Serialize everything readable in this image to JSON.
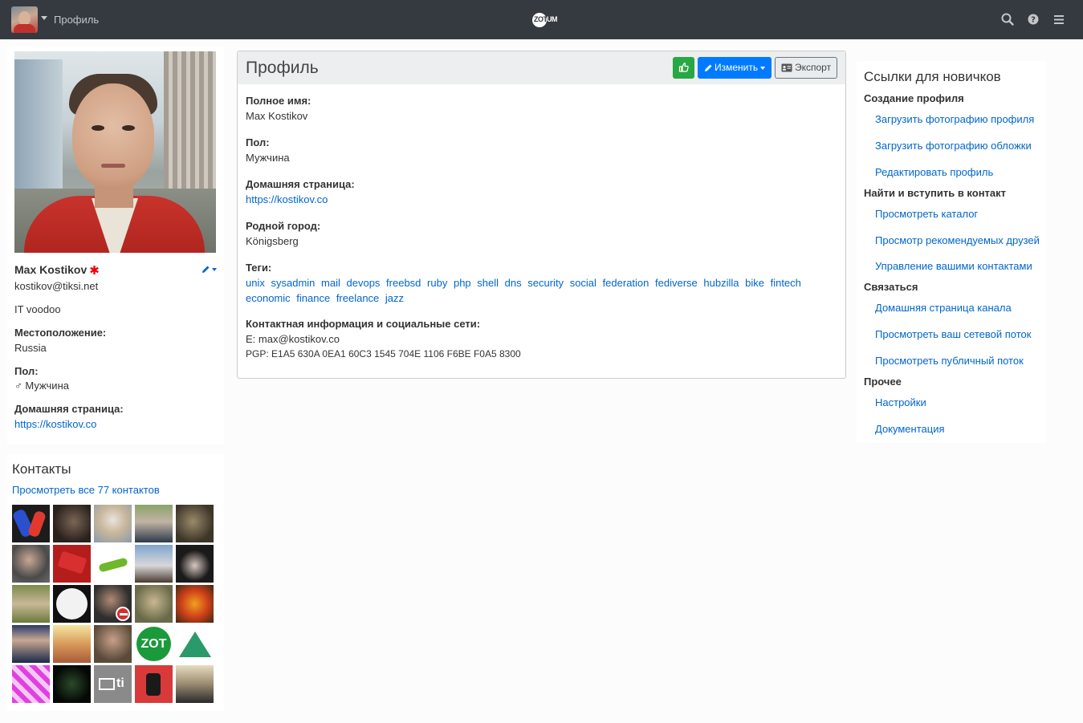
{
  "navbar": {
    "title": "Профиль",
    "logo_text_a": "ZOT",
    "logo_text_b": "UM",
    "icons": [
      "search-icon",
      "help-icon",
      "menu-icon"
    ]
  },
  "left": {
    "name": "Max Kostikov",
    "verified_glyph": "✱",
    "address": "kostikov@tiksi.net",
    "about": "IT voodoo",
    "location_label": "Местоположение:",
    "location_value": "Russia",
    "gender_label": "Пол:",
    "gender_value": "♂ Мужчина",
    "homepage_label": "Домашняя страница:",
    "homepage_value": "https://kostikov.co"
  },
  "contacts": {
    "title": "Контакты",
    "view_all": "Просмотреть все 77 контактов",
    "avatars": 25
  },
  "main": {
    "title": "Профиль",
    "edit_label": "Изменить",
    "export_label": "Экспорт",
    "fields": {
      "fullname_label": "Полное имя:",
      "fullname_value": "Max Kostikov",
      "gender_label": "Пол:",
      "gender_value": "Мужчина",
      "homepage_label": "Домашняя страница:",
      "homepage_value": "https://kostikov.co",
      "hometown_label": "Родной город:",
      "hometown_value": "Königsberg",
      "tags_label": "Теги:",
      "contact_label": "Контактная информация и социальные сети:",
      "email_line": "E: max@kostikov.co",
      "pgp_line": "PGP: E1A5 630A 0EA1 60C3 1545 704E 1106 F6BE F0A5 8300"
    },
    "tags": [
      "unix",
      "sysadmin",
      "mail",
      "devops",
      "freebsd",
      "ruby",
      "php",
      "shell",
      "dns",
      "security",
      "social",
      "federation",
      "fediverse",
      "hubzilla",
      "bike",
      "fintech",
      "economic",
      "finance",
      "freelance",
      "jazz"
    ]
  },
  "right": {
    "title": "Ссылки для новичков",
    "sections": [
      {
        "title": "Создание профиля",
        "links": [
          "Загрузить фотографию профиля",
          "Загрузить фотографию обложки",
          "Редактировать профиль"
        ]
      },
      {
        "title": "Найти и вступить в контакт",
        "links": [
          "Просмотреть каталог",
          "Просмотр рекомендуемых друзей",
          "Управление вашими контактами"
        ]
      },
      {
        "title": "Связаться",
        "links": [
          "Домашняя страница канала",
          "Просмотреть ваш сетевой поток",
          "Просмотреть публичный поток"
        ]
      },
      {
        "title": "Прочее",
        "links": [
          "Настройки",
          "Документация"
        ]
      }
    ]
  },
  "colors": {
    "navbar_bg": "#343a40",
    "link": "#0066cc",
    "like_button": "#28a745",
    "edit_button": "#007bff",
    "verified": "#ee0000"
  }
}
